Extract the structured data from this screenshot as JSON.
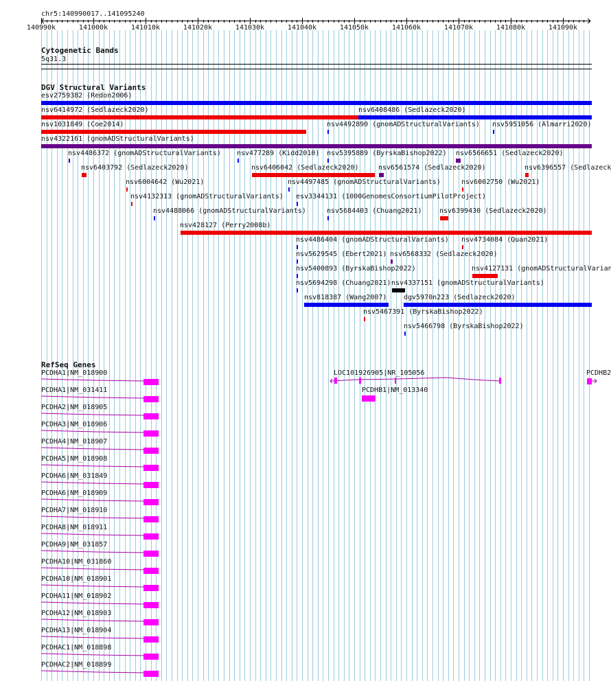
{
  "ruler": {
    "locus": "chr5:140990017..141095240",
    "ticks": [
      "140990k",
      "141000k",
      "141010k",
      "141020k",
      "141030k",
      "141040k",
      "141050k",
      "141060k",
      "141070k",
      "141080k",
      "141090k"
    ]
  },
  "cytoband": {
    "title": "Cytogenetic Bands",
    "band": "5q31.3"
  },
  "dgv": {
    "title": "DGV Structural Variants",
    "features": [
      {
        "label": "esv2759382 (Redon2006)",
        "color": "#0000ee"
      },
      {
        "label": "nsv6414972 (Sedlazeck2020)",
        "color": "#ee0000"
      },
      {
        "label": "nsv6408486 (Sedlazeck2020)",
        "color": "#0000ee"
      },
      {
        "label": "nsv1031849 (Coe2014)",
        "color": "#ee0000"
      },
      {
        "label": "nsv4492890 (gnomADStructuralVariants)",
        "color": "#0000ee"
      },
      {
        "label": "nsv5951056 (Almarri2020)",
        "color": "#0000ee"
      },
      {
        "label": "nsv4322161 (gnomADStructuralVariants)",
        "color": "#660088"
      },
      {
        "label": "nsv4486372 (gnomADStructuralVariants)",
        "color": "#0000ee"
      },
      {
        "label": "nsv477289 (Kidd2010)",
        "color": "#0000ee"
      },
      {
        "label": "nsv5395889 (ByrskaBishop2022)",
        "color": "#0000ee"
      },
      {
        "label": "nsv6566651 (Sedlazeck2020)",
        "color": "#660088"
      },
      {
        "label": "nsv6403792 (Sedlazeck2020)",
        "color": "#ee0000"
      },
      {
        "label": "nsv6406042 (Sedlazeck2020)",
        "color": "#ee0000"
      },
      {
        "label": "nsv6561574 (Sedlazeck2020)",
        "color": "#660088"
      },
      {
        "label": "nsv6396557 (Sedlazeck",
        "color": "#ee0000"
      },
      {
        "label": "nsv6004642 (Wu2021)",
        "color": "#ee0000"
      },
      {
        "label": "nsv4497485 (gnomADStructuralVariants)",
        "color": "#0000ee"
      },
      {
        "label": "nsv6002750 (Wu2021)",
        "color": "#ee0000"
      },
      {
        "label": "nsv4132313 (gnomADStructuralVariants)",
        "color": "#ee0000"
      },
      {
        "label": "esv3344131 (1000GenomesConsortiumPilotProject)",
        "color": "#0000ee"
      },
      {
        "label": "nsv4488066 (gnomADStructuralVariants)",
        "color": "#0000ee"
      },
      {
        "label": "nsv5684403 (Chuang2021)",
        "color": "#0000ee"
      },
      {
        "label": "nsv6399430 (Sedlazeck2020)",
        "color": "#ee0000"
      },
      {
        "label": "nsv428127 (Perry2008b)",
        "color": "#ee0000"
      },
      {
        "label": "nsv4486404 (gnomADStructuralVariants)",
        "color": "#0000ee"
      },
      {
        "label": "nsv4734084 (Quan2021)",
        "color": "#ee0000"
      },
      {
        "label": "nsv5629545 (Ebert2021)",
        "color": "#0000ee"
      },
      {
        "label": "nsv6568332 (Sedlazeck2020)",
        "color": "#660088"
      },
      {
        "label": "nsv5400893 (ByrskaBishop2022)",
        "color": "#0000ee"
      },
      {
        "label": "nsv4127131 (gnomADStructuralVarian",
        "color": "#ee0000"
      },
      {
        "label": "nsv5694298 (Chuang2021)",
        "color": "#0000ee"
      },
      {
        "label": "nsv4337151 (gnomADStructuralVariants)",
        "color": "#000000"
      },
      {
        "label": "nsv818387 (Wang2007)",
        "color": "#0000ee"
      },
      {
        "label": "dgv5970n223 (Sedlazeck2020)",
        "color": "#0000ee"
      },
      {
        "label": "nsv5467391 (ByrskaBishop2022)",
        "color": "#ee0000"
      },
      {
        "label": "nsv5466798 (ByrskaBishop2022)",
        "color": "#0000ee"
      }
    ]
  },
  "refseq": {
    "title": "RefSeq Genes",
    "genes": [
      {
        "label": "PCDHA1|NM_018900"
      },
      {
        "label": "LOC101926905|NR_105056"
      },
      {
        "label": "PCDHB2"
      },
      {
        "label": "PCDHA1|NM_031411"
      },
      {
        "label": "PCDHB1|NM_013340"
      },
      {
        "label": "PCDHA2|NM_018905"
      },
      {
        "label": "PCDHA3|NM_018906"
      },
      {
        "label": "PCDHA4|NM_018907"
      },
      {
        "label": "PCDHA5|NM_018908"
      },
      {
        "label": "PCDHA6|NM_031849"
      },
      {
        "label": "PCDHA6|NM_018909"
      },
      {
        "label": "PCDHA7|NM_018910"
      },
      {
        "label": "PCDHA8|NM_018911"
      },
      {
        "label": "PCDHA9|NM_031857"
      },
      {
        "label": "PCDHA10|NM_031860"
      },
      {
        "label": "PCDHA10|NM_018901"
      },
      {
        "label": "PCDHA11|NM_018902"
      },
      {
        "label": "PCDHA12|NM_018903"
      },
      {
        "label": "PCDHA13|NM_018904"
      },
      {
        "label": "PCDHAC1|NM_018898"
      },
      {
        "label": "PCDHAC2|NM_018899"
      }
    ]
  },
  "colors": {
    "grid": "#99ccdd",
    "gene": "#ff00ff",
    "gene_line": "#aa00aa"
  }
}
